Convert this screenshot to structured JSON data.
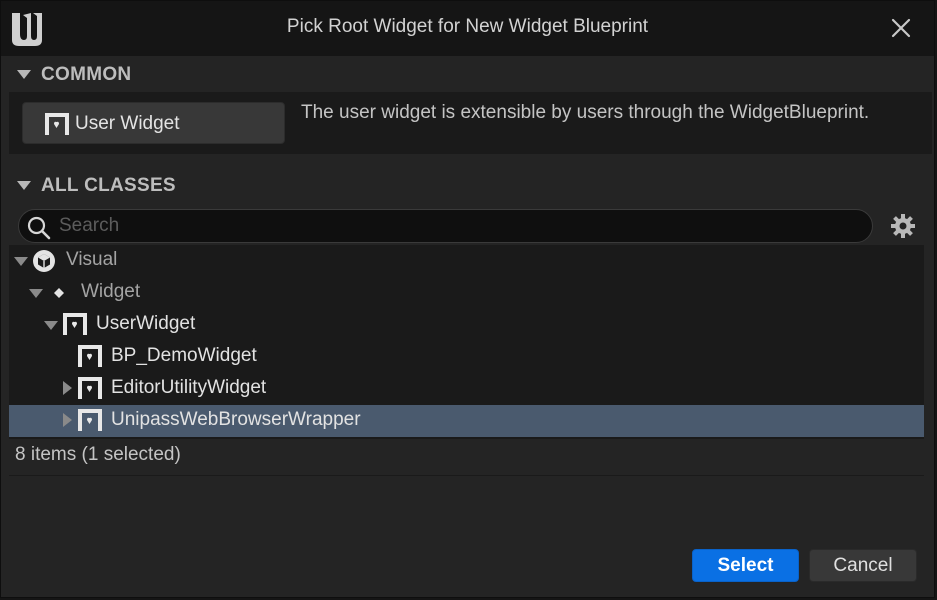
{
  "window": {
    "title": "Pick Root Widget for New Widget Blueprint"
  },
  "common": {
    "header": "COMMON",
    "button_label": "User Widget",
    "description": "The user widget is extensible by users through the WidgetBlueprint."
  },
  "all_classes": {
    "header": "ALL CLASSES",
    "search_placeholder": "Search",
    "search_value": ""
  },
  "tree": {
    "items": [
      {
        "label": "Visual",
        "icon": "visual-cube-icon",
        "expanded": true,
        "selected": false
      },
      {
        "label": "Widget",
        "icon": "widget-diamond-icon",
        "expanded": true,
        "selected": false
      },
      {
        "label": "UserWidget",
        "icon": "user-widget-icon",
        "expanded": true,
        "selected": false
      },
      {
        "label": "BP_DemoWidget",
        "icon": "user-widget-icon",
        "expanded": null,
        "selected": false
      },
      {
        "label": "EditorUtilityWidget",
        "icon": "user-widget-icon",
        "expanded": false,
        "selected": false
      },
      {
        "label": "UnipassWebBrowserWrapper",
        "icon": "user-widget-icon",
        "expanded": false,
        "selected": true
      }
    ]
  },
  "status": {
    "text": "8 items (1 selected)"
  },
  "buttons": {
    "select": "Select",
    "cancel": "Cancel"
  },
  "colors": {
    "accent": "#0a70e4",
    "selection": "#4a5a6e",
    "background": "#242424"
  }
}
